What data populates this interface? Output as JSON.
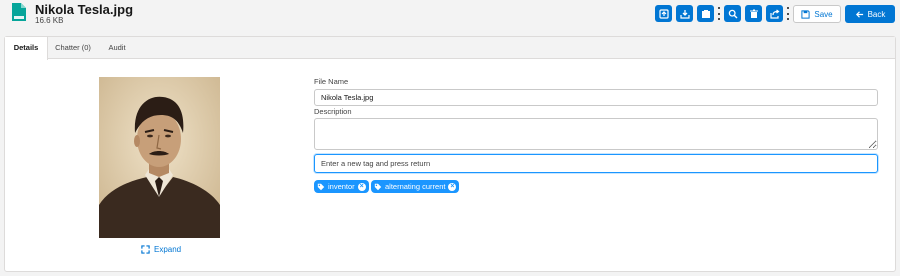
{
  "header": {
    "title": "Nikola Tesla.jpg",
    "subtitle": "16.6 KB",
    "file_icon_label": "JPG"
  },
  "toolbar": {
    "buttons": [
      {
        "name": "preview-icon"
      },
      {
        "name": "download-icon"
      },
      {
        "name": "file-icon"
      },
      {
        "name": "search-icon"
      },
      {
        "name": "delete-icon"
      },
      {
        "name": "share-icon"
      }
    ],
    "save_label": "Save",
    "back_label": "Back"
  },
  "tabs": [
    {
      "label": "Details",
      "active": true
    },
    {
      "label": "Chatter (0)",
      "active": false
    },
    {
      "label": "Audit",
      "active": false
    }
  ],
  "preview": {
    "expand_label": "Expand"
  },
  "form": {
    "file_name_label": "File Name",
    "file_name_value": "Nikola Tesla.jpg",
    "description_label": "Description",
    "description_value": "",
    "tag_placeholder": "Enter a new tag and press return"
  },
  "tags": [
    "inventor",
    "alternating current"
  ],
  "colors": {
    "brand": "#0176d3",
    "tag": "#1b96ff",
    "background": "#f3f3f3"
  }
}
